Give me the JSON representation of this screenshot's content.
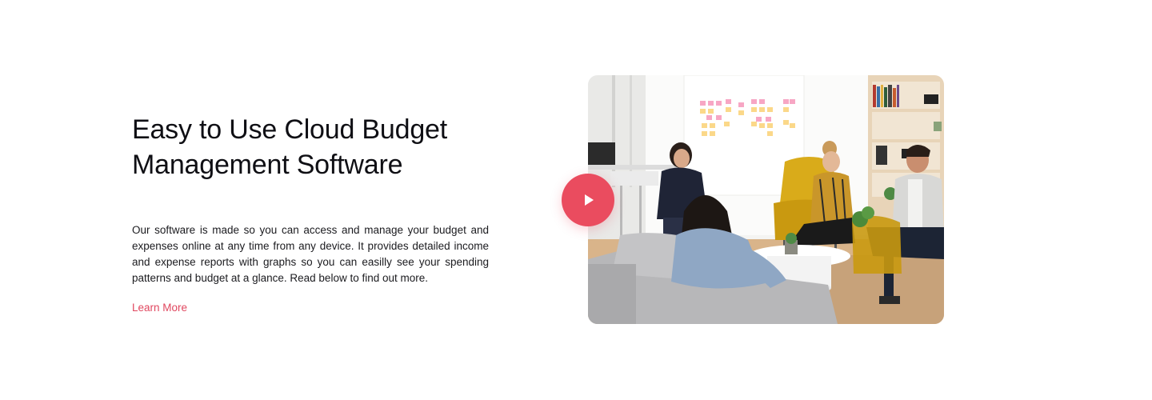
{
  "feature": {
    "title_line1": "Easy to Use Cloud Budget",
    "title_line2": "Management Software",
    "description": "Our software is made so you can access and manage your budget and expenses online at any time from any device. It provides detailed income and expense reports with graphs so you can easilly see your spending patterns and budget at a glance. Read below to find out more.",
    "cta_label": "Learn More"
  },
  "video": {
    "play_icon": "play-icon"
  },
  "colors": {
    "accent": "#ea4c5f",
    "link": "#e0475f",
    "heading": "#0f0f14"
  }
}
